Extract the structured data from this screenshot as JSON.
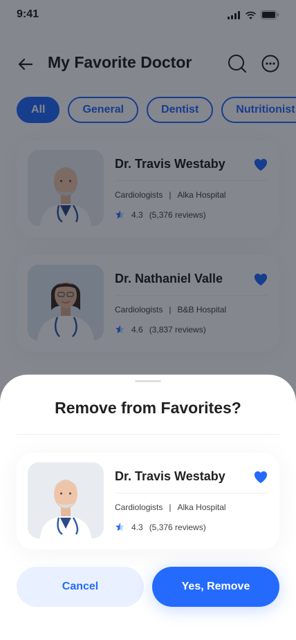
{
  "status_bar": {
    "time": "9:41"
  },
  "header": {
    "title": "My Favorite Doctor"
  },
  "categories": [
    {
      "label": "All",
      "active": true
    },
    {
      "label": "General",
      "active": false
    },
    {
      "label": "Dentist",
      "active": false
    },
    {
      "label": "Nutritionist",
      "active": false
    }
  ],
  "doctors": [
    {
      "name": "Dr. Travis Westaby",
      "specialty": "Cardiologists",
      "separator": "|",
      "hospital": "Alka Hospital",
      "rating": "4.3",
      "reviews": "(5,376 reviews)"
    },
    {
      "name": "Dr. Nathaniel Valle",
      "specialty": "Cardiologists",
      "separator": "|",
      "hospital": "B&B Hospital",
      "rating": "4.6",
      "reviews": "(3,837 reviews)"
    }
  ],
  "sheet": {
    "title": "Remove from Favorites?",
    "doctor": {
      "name": "Dr. Travis Westaby",
      "specialty": "Cardiologists",
      "separator": "|",
      "hospital": "Alka Hospital",
      "rating": "4.3",
      "reviews": "(5,376 reviews)"
    },
    "cancel_label": "Cancel",
    "confirm_label": "Yes, Remove"
  },
  "colors": {
    "primary": "#246bfd",
    "primary_light": "#e9f0ff",
    "heart": "#246bfd",
    "text": "#212121"
  },
  "icons": {
    "back": "arrow-left-icon",
    "search": "search-icon",
    "more": "more-circle-icon",
    "favorite": "heart-icon",
    "rating": "half-star-icon"
  }
}
